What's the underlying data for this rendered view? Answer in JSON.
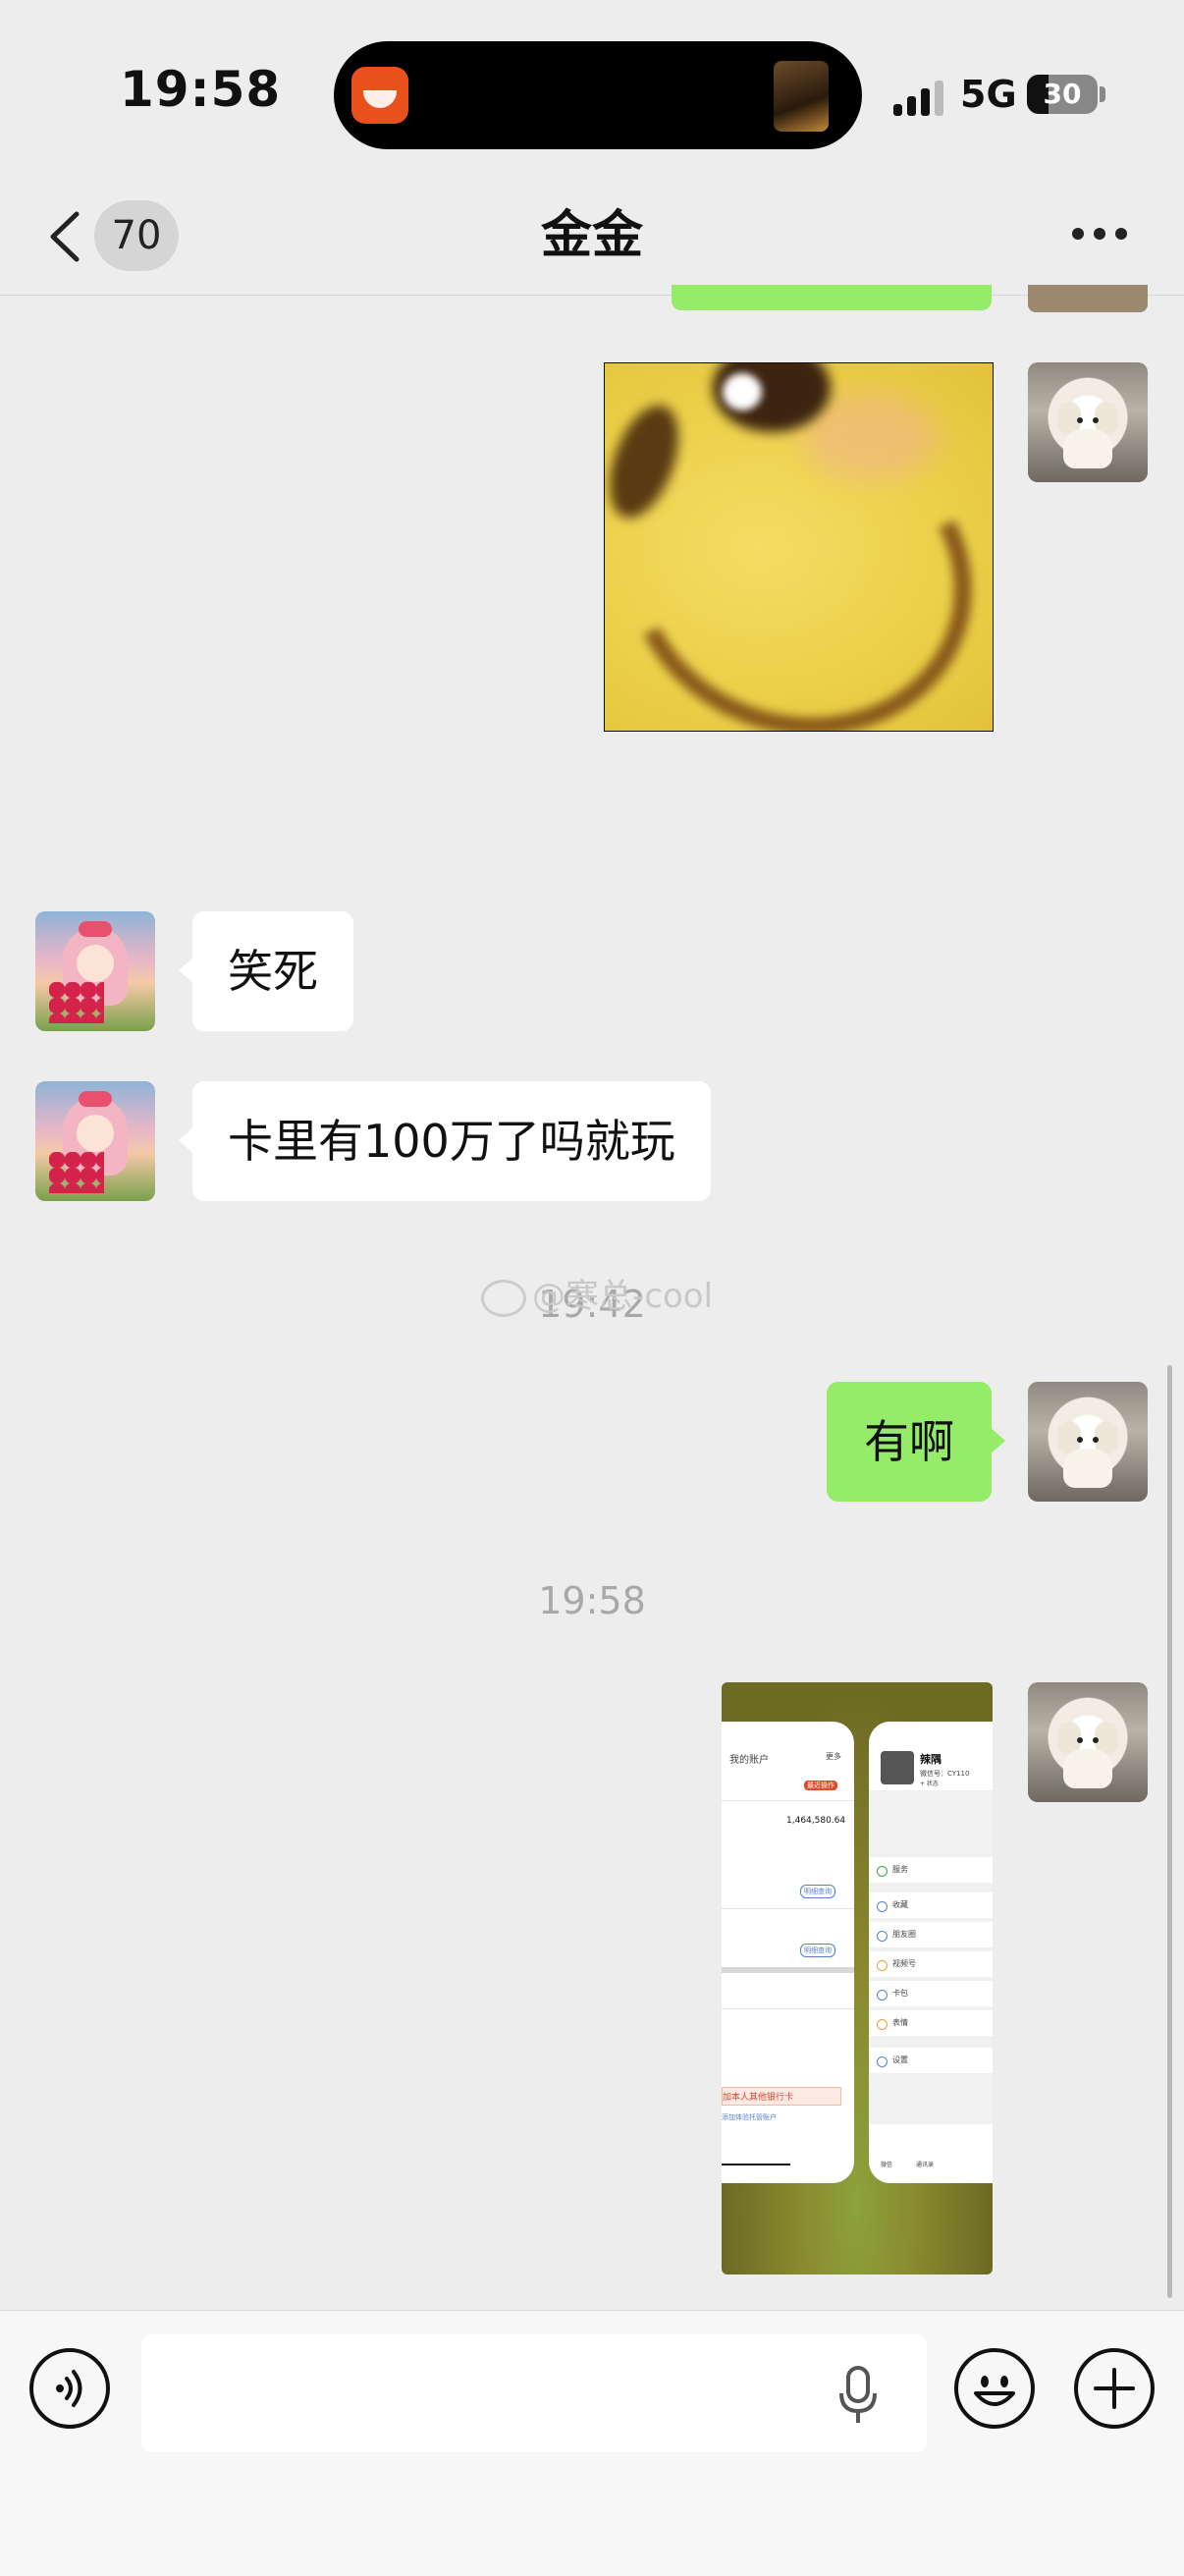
{
  "status_bar": {
    "time": "19:58",
    "network": "5G",
    "battery": "30",
    "battery_level": 0.3
  },
  "nav": {
    "back_icon": "chevron-left-icon",
    "unread_count": "70",
    "title": "金金",
    "more_icon": "ellipsis-icon"
  },
  "messages": [
    {
      "side": "right",
      "type": "image",
      "content": "smiley-face"
    },
    {
      "side": "left",
      "type": "text",
      "text": "笑死"
    },
    {
      "side": "left",
      "type": "text",
      "text": "卡里有100万了吗就玩"
    },
    {
      "type": "timestamp",
      "text": "19:42"
    },
    {
      "side": "right",
      "type": "text",
      "text": "有啊"
    },
    {
      "type": "timestamp",
      "text": "19:58"
    },
    {
      "side": "right",
      "type": "image",
      "content": "app-switcher-screenshot"
    }
  ],
  "watermark": "@寒总-cool",
  "screenshot": {
    "left_card": {
      "title": "我的账户",
      "more": "更多",
      "tag": "最近操作",
      "amount": "1,464,580.64",
      "detail_label": "明细查询",
      "notice": "加本人其他银行卡",
      "link": "添加体验托管账户"
    },
    "right_card": {
      "name": "辣隅",
      "wechat_id": "微信号：CY110",
      "status": "+ 状态",
      "menu": [
        "服务",
        "收藏",
        "朋友圈",
        "视频号",
        "卡包",
        "表情",
        "设置"
      ],
      "tabs": [
        "微信",
        "通讯录"
      ]
    }
  },
  "input_bar": {
    "voice_icon": "voice-icon",
    "mic_icon": "mic-icon",
    "emoji_icon": "emoji-icon",
    "plus_icon": "plus-icon",
    "placeholder": ""
  },
  "colors": {
    "background": "#ededed",
    "sent_bubble": "#95ec69",
    "received_bubble": "#ffffff",
    "timestamp": "#a8a8a8"
  }
}
